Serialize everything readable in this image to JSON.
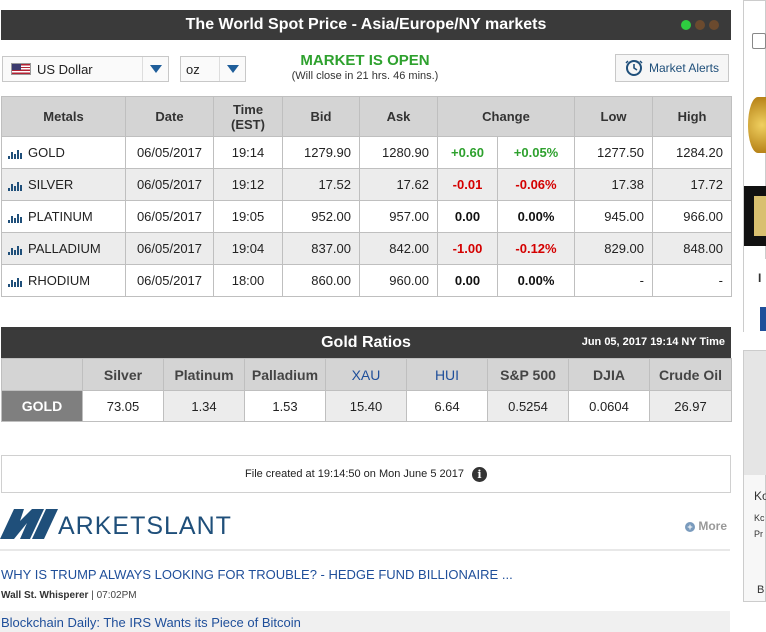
{
  "header": {
    "title": "The World Spot Price - Asia/Europe/NY markets",
    "dot_colors": [
      "#2ecc40",
      "#7a4b2a",
      "#7a4b2a"
    ]
  },
  "controls": {
    "currency": "US Dollar",
    "unit": "oz",
    "market_status": "MARKET IS OPEN",
    "market_close_note": "(Will close in 21 hrs. 46 mins.)",
    "alerts_label": "Market Alerts"
  },
  "metals_table": {
    "headers": [
      "Metals",
      "Date",
      "Time (EST)",
      "Bid",
      "Ask",
      "Change",
      "Low",
      "High"
    ],
    "time_header_line1": "Time",
    "time_header_line2": "(EST)",
    "rows": [
      {
        "metal": "GOLD",
        "date": "06/05/2017",
        "time": "19:14",
        "bid": "1279.90",
        "ask": "1280.90",
        "change": "+0.60",
        "change_pct": "+0.05%",
        "low": "1277.50",
        "high": "1284.20",
        "trend": "pos"
      },
      {
        "metal": "SILVER",
        "date": "06/05/2017",
        "time": "19:12",
        "bid": "17.52",
        "ask": "17.62",
        "change": "-0.01",
        "change_pct": "-0.06%",
        "low": "17.38",
        "high": "17.72",
        "trend": "neg"
      },
      {
        "metal": "PLATINUM",
        "date": "06/05/2017",
        "time": "19:05",
        "bid": "952.00",
        "ask": "957.00",
        "change": "0.00",
        "change_pct": "0.00%",
        "low": "945.00",
        "high": "966.00",
        "trend": "zero"
      },
      {
        "metal": "PALLADIUM",
        "date": "06/05/2017",
        "time": "19:04",
        "bid": "837.00",
        "ask": "842.00",
        "change": "-1.00",
        "change_pct": "-0.12%",
        "low": "829.00",
        "high": "848.00",
        "trend": "neg"
      },
      {
        "metal": "RHODIUM",
        "date": "06/05/2017",
        "time": "18:00",
        "bid": "860.00",
        "ask": "960.00",
        "change": "0.00",
        "change_pct": "0.00%",
        "low": "-",
        "high": "-",
        "trend": "zero"
      }
    ]
  },
  "gold_ratios": {
    "title": "Gold Ratios",
    "timestamp": "Jun 05, 2017 19:14 NY Time",
    "headers": [
      "Silver",
      "Platinum",
      "Palladium",
      "XAU",
      "HUI",
      "S&P 500",
      "DJIA",
      "Crude Oil"
    ],
    "row_label": "GOLD",
    "values": [
      "73.05",
      "1.34",
      "1.53",
      "15.40",
      "6.64",
      "0.5254",
      "0.0604",
      "26.97"
    ]
  },
  "file_info": {
    "text": "File created at 19:14:50 on Mon June 5 2017",
    "icon": "info-icon"
  },
  "marketslant": {
    "logo_text": "ARKETSLANT",
    "more_label": "More",
    "news": [
      {
        "headline": "WHY IS TRUMP ALWAYS LOOKING FOR TROUBLE? - HEDGE FUND BILLIONAIRE ...",
        "source": "Wall St. Whisperer",
        "time": "07:02PM"
      },
      {
        "headline": "Blockchain Daily: The IRS Wants its Piece of Bitcoin"
      }
    ]
  },
  "side_ads": {
    "letter_ko": "Ko",
    "letter_k": "Kc",
    "letter_p": "Pr",
    "letter_b": "B",
    "letter_i": "I"
  },
  "colors": {
    "header_bg": "#3a3a3a",
    "positive": "#2ea12e",
    "negative": "#d40000",
    "link": "#1f4f9a",
    "brand": "#1f4f7a"
  }
}
